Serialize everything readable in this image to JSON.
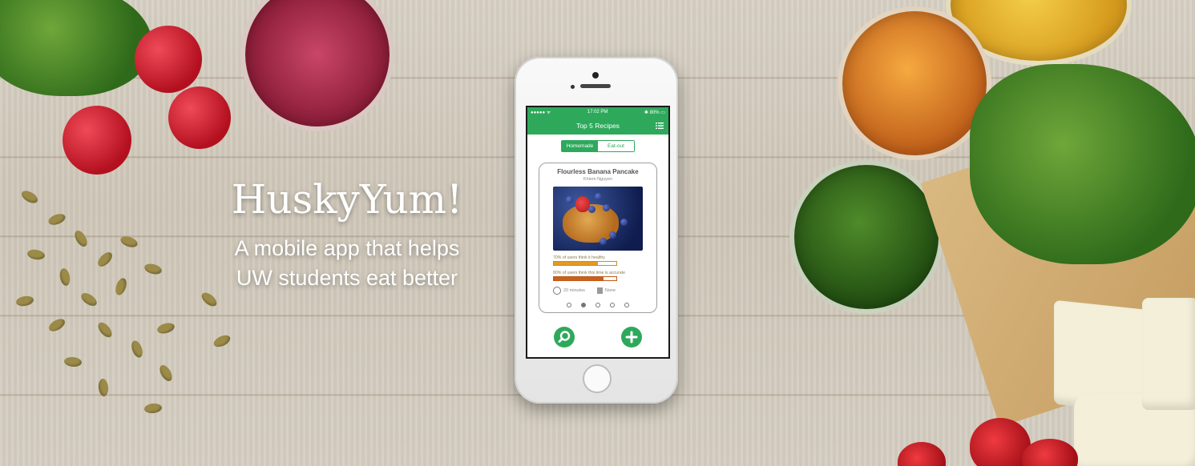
{
  "hero": {
    "brand_title": "HuskyYum!",
    "tagline_line1": "A mobile app that helps",
    "tagline_line2": "UW students eat better"
  },
  "phone": {
    "status_bar": {
      "time": "17:02 PM",
      "battery": "80%"
    },
    "nav": {
      "title": "Top 5 Recipes",
      "menu_icon": "list-icon"
    },
    "segmented": {
      "options": [
        "Homemade",
        "Eat-out"
      ],
      "selected": "Homemade"
    },
    "recipe_card": {
      "title": "Flourless Banana Pancake",
      "author": "Khiem Nguyen",
      "healthy_text": "70% of users think it healthy",
      "healthy_fraction": 0.7,
      "accurate_text": "80% of users think this time is accurate",
      "accurate_fraction": 0.8,
      "time": "20 minutes",
      "waste": "None",
      "pagination": {
        "count": 5,
        "active_index": 1
      }
    },
    "actions": {
      "search_icon": "search-icon",
      "add_icon": "plus-icon"
    }
  },
  "colors": {
    "accent": "#2ea95c",
    "healthy_bar": "#e29a21",
    "accurate_bar": "#c86020"
  }
}
